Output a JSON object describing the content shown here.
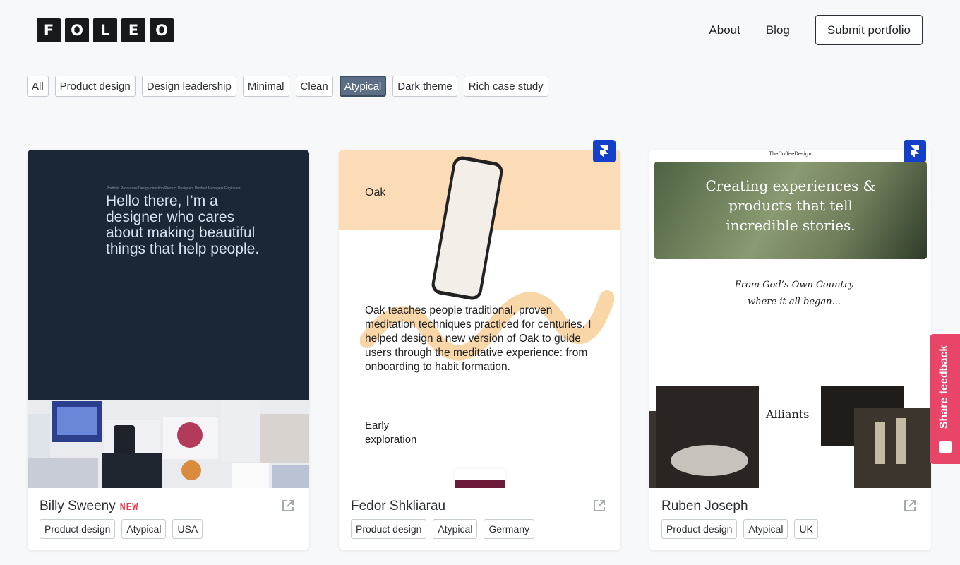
{
  "brand": {
    "letters": [
      "F",
      "O",
      "L",
      "E",
      "O"
    ]
  },
  "nav": {
    "about": "About",
    "blog": "Blog",
    "submit": "Submit portfolio"
  },
  "filters": [
    "All",
    "Product design",
    "Design leadership",
    "Minimal",
    "Clean",
    "Atypical",
    "Dark theme",
    "Rich case study"
  ],
  "active_filter": "Atypical",
  "cards": [
    {
      "name": "Billy Sweeny",
      "badge": "NEW",
      "tags": [
        "Product design",
        "Atypical",
        "USA"
      ],
      "preview": {
        "nav": "Portfolio   Resources   Design direction   Product Designers   Product Managers   Engineers",
        "hero": "Hello there, I’m a designer who cares about making beautiful things that help people."
      }
    },
    {
      "name": "Fedor Shkliarau",
      "tags": [
        "Product design",
        "Atypical",
        "Germany"
      ],
      "preview": {
        "title": "Oak",
        "body": "Oak teaches people traditional, proven meditation techniques practiced for centuries. I helped design a new version of Oak to guide users through the meditative experience: from onboarding to habit formation.",
        "section": "Early exploration"
      }
    },
    {
      "name": "Ruben Joseph",
      "tags": [
        "Product design",
        "Atypical",
        "UK"
      ],
      "preview": {
        "site_name": "TheCoffeeDesign",
        "hero": "Creating experiences & products that tell incredible stories.",
        "story": "From God’s Own Country where it all began...",
        "project": "Alliants"
      }
    }
  ],
  "feedback": {
    "label": "Share feedback"
  },
  "colors": {
    "accent_active": "#5b6e86",
    "new_badge": "#e8334a",
    "feedback": "#e84569",
    "framer_badge": "#1440c9"
  },
  "icons": [
    "external-link-icon",
    "framer-icon",
    "chat-icon"
  ]
}
